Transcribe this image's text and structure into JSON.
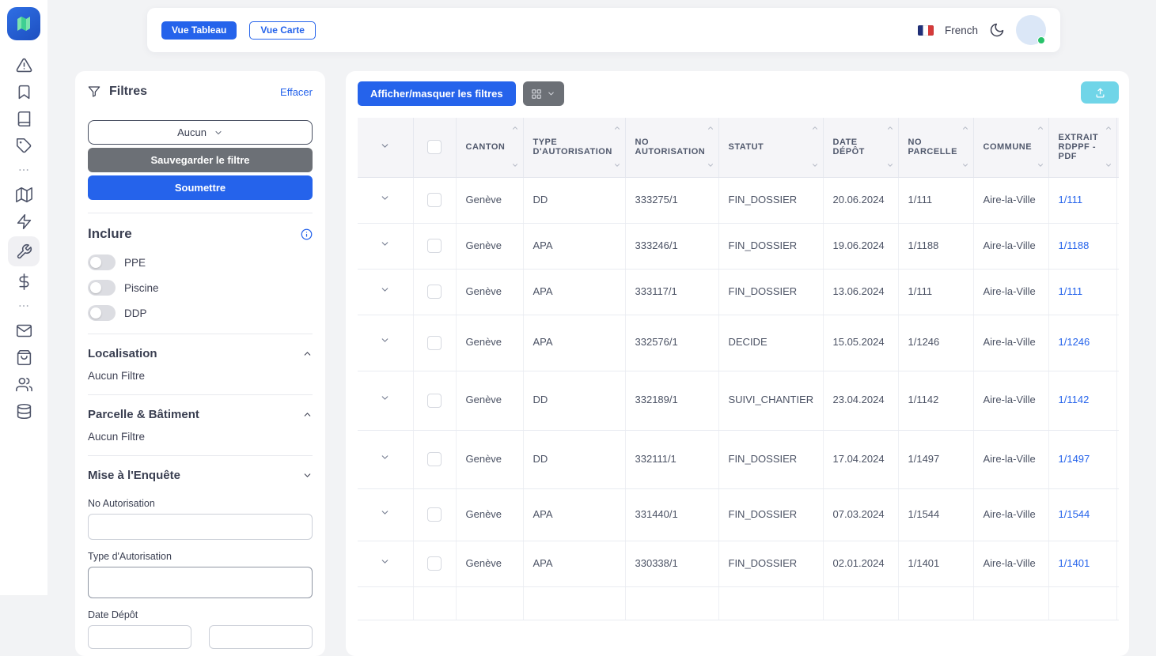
{
  "topbar": {
    "view_table_label": "Vue Tableau",
    "view_map_label": "Vue Carte",
    "language_label": "French"
  },
  "sidebar": {
    "icons": [
      "alert-triangle",
      "bookmark",
      "book",
      "tag",
      "dots",
      "map",
      "zap",
      "wrench",
      "dollar",
      "dots",
      "mail",
      "shopping-bag",
      "users",
      "database"
    ],
    "active_icon": "wrench"
  },
  "filters": {
    "title": "Filtres",
    "clear_label": "Effacer",
    "preset_value": "Aucun",
    "save_label": "Sauvegarder le filtre",
    "submit_label": "Soumettre",
    "include": {
      "title": "Inclure",
      "toggles": [
        {
          "label": "PPE",
          "on": false
        },
        {
          "label": "Piscine",
          "on": false
        },
        {
          "label": "DDP",
          "on": false
        }
      ]
    },
    "sections": [
      {
        "label": "Localisation",
        "empty_text": "Aucun Filtre",
        "collapsed": false
      },
      {
        "label": "Parcelle & Bâtiment",
        "empty_text": "Aucun Filtre",
        "collapsed": false
      },
      {
        "label": "Mise à l'Enquête",
        "collapsed": true
      }
    ],
    "fields": {
      "no_autorisation": {
        "label": "No Autorisation",
        "value": "",
        "placeholder": ""
      },
      "type_autorisation": {
        "label": "Type d'Autorisation",
        "value": "",
        "placeholder": ""
      },
      "date_depot": {
        "label": "Date Dépôt",
        "from_value": "",
        "to_value": ""
      }
    }
  },
  "main": {
    "toggle_filters_label": "Afficher/masquer les filtres",
    "table": {
      "columns": [
        "CANTON",
        "TYPE D'AUTORISATION",
        "NO AUTORISATION",
        "STATUT",
        "DATE DÉPÔT",
        "NO PARCELLE",
        "COMMUNE",
        "EXTRAIT RDPPF - PDF"
      ],
      "rows": [
        {
          "canton": "Genève",
          "type": "DD",
          "no_autorisation": "333275/1",
          "statut": "FIN_DOSSIER",
          "date_depot": "20.06.2024",
          "no_parcelle": "1/111",
          "commune": "Aire-la-Ville",
          "extrait": "1/111"
        },
        {
          "canton": "Genève",
          "type": "APA",
          "no_autorisation": "333246/1",
          "statut": "FIN_DOSSIER",
          "date_depot": "19.06.2024",
          "no_parcelle": "1/1188",
          "commune": "Aire-la-Ville",
          "extrait": "1/1188"
        },
        {
          "canton": "Genève",
          "type": "APA",
          "no_autorisation": "333117/1",
          "statut": "FIN_DOSSIER",
          "date_depot": "13.06.2024",
          "no_parcelle": "1/111",
          "commune": "Aire-la-Ville",
          "extrait": "1/111"
        },
        {
          "canton": "Genève",
          "type": "APA",
          "no_autorisation": "332576/1",
          "statut": "DECIDE",
          "date_depot": "15.05.2024",
          "no_parcelle": "1/1246",
          "commune": "Aire-la-Ville",
          "extrait": "1/1246"
        },
        {
          "canton": "Genève",
          "type": "DD",
          "no_autorisation": "332189/1",
          "statut": "SUIVI_CHANTIER",
          "date_depot": "23.04.2024",
          "no_parcelle": "1/1142",
          "commune": "Aire-la-Ville",
          "extrait": "1/1142"
        },
        {
          "canton": "Genève",
          "type": "DD",
          "no_autorisation": "332111/1",
          "statut": "FIN_DOSSIER",
          "date_depot": "17.04.2024",
          "no_parcelle": "1/1497",
          "commune": "Aire-la-Ville",
          "extrait": "1/1497"
        },
        {
          "canton": "Genève",
          "type": "APA",
          "no_autorisation": "331440/1",
          "statut": "FIN_DOSSIER",
          "date_depot": "07.03.2024",
          "no_parcelle": "1/1544",
          "commune": "Aire-la-Ville",
          "extrait": "1/1544"
        },
        {
          "canton": "Genève",
          "type": "APA",
          "no_autorisation": "330338/1",
          "statut": "FIN_DOSSIER",
          "date_depot": "02.01.2024",
          "no_parcelle": "1/1401",
          "commune": "Aire-la-Ville",
          "extrait": "1/1401"
        },
        {
          "canton": "",
          "type": "",
          "no_autorisation": "",
          "statut": "",
          "date_depot": "",
          "no_parcelle": "",
          "commune": "",
          "extrait": ""
        }
      ]
    }
  },
  "colors": {
    "primary_blue": "#2563eb",
    "export_cyan": "#70d5e8",
    "save_gray": "#6c7076",
    "link_blue": "#2563eb",
    "online_green": "#27c26a"
  }
}
